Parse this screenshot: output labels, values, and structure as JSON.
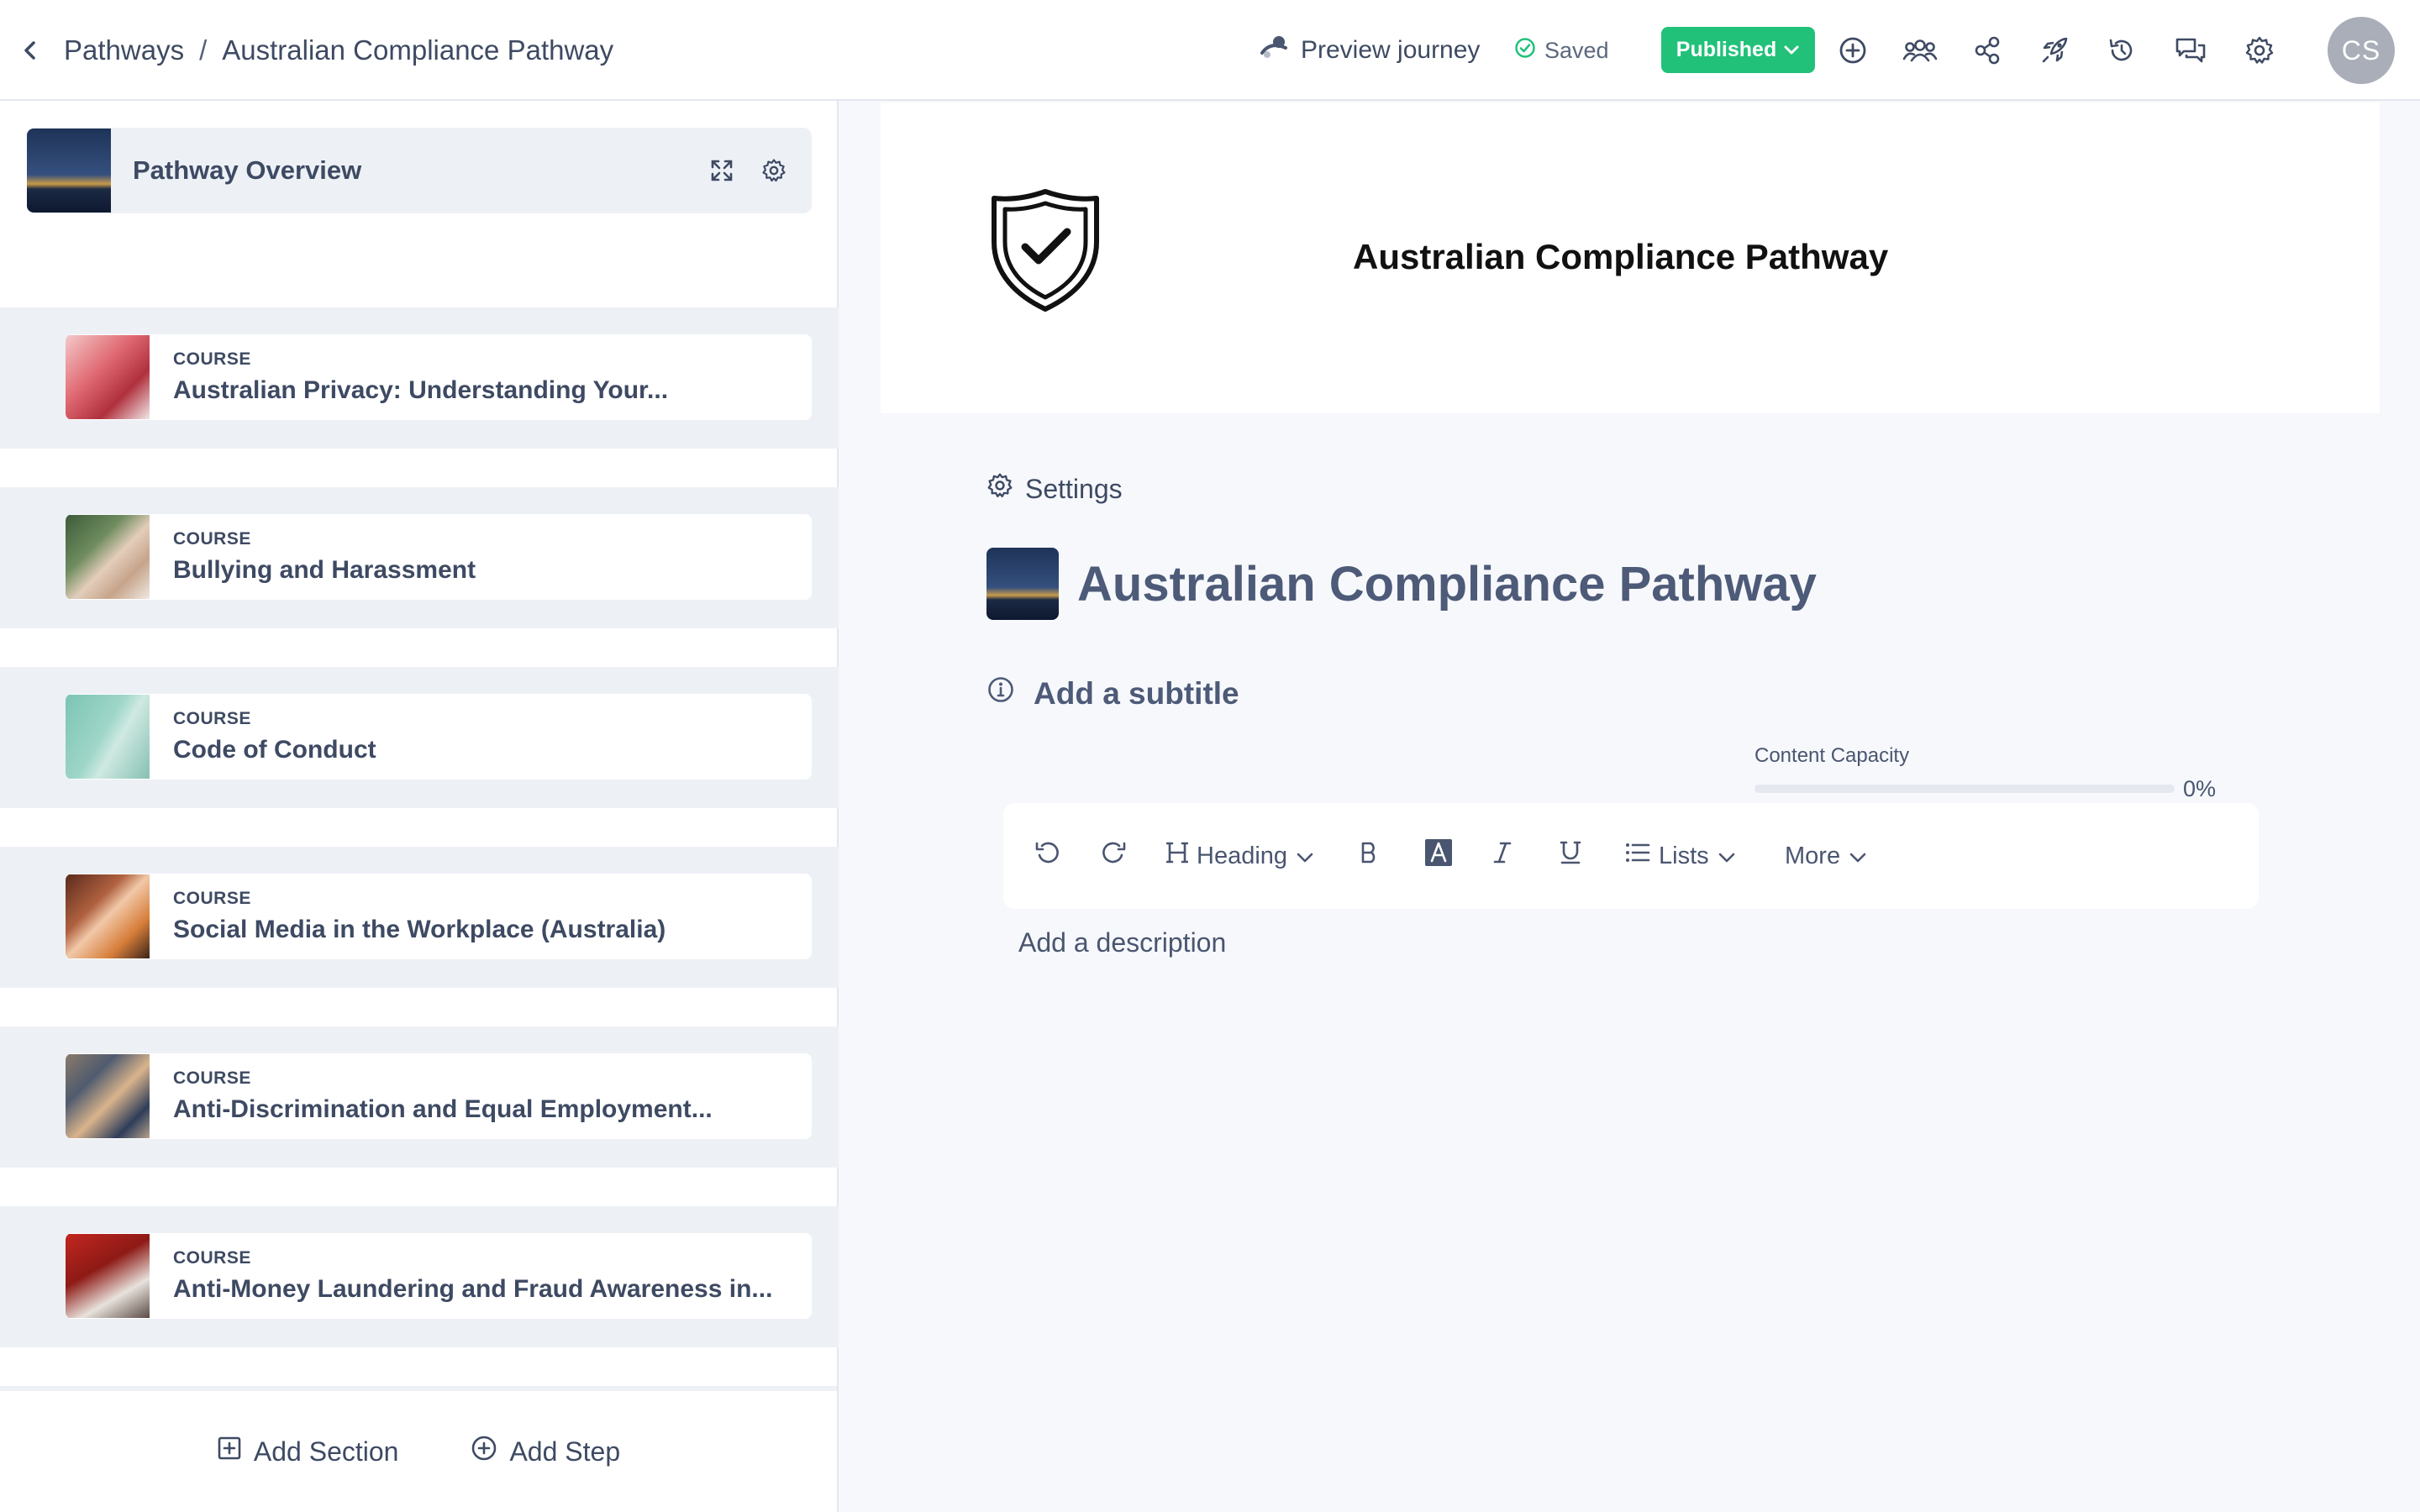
{
  "header": {
    "breadcrumb": [
      "Pathways",
      "/",
      "Australian Compliance Pathway"
    ],
    "preview_label": "Preview journey",
    "saved_label": "Saved",
    "status_label": "Published",
    "avatar_initials": "CS"
  },
  "sidebar": {
    "overview_label": "Pathway Overview",
    "steps": [
      {
        "kind": "COURSE",
        "title": "Australian Privacy: Understanding Your..."
      },
      {
        "kind": "COURSE",
        "title": "Bullying and Harassment"
      },
      {
        "kind": "COURSE",
        "title": "Code of Conduct"
      },
      {
        "kind": "COURSE",
        "title": "Social Media in the Workplace (Australia)"
      },
      {
        "kind": "COURSE",
        "title": "Anti-Discrimination and Equal Employment..."
      },
      {
        "kind": "COURSE",
        "title": "Anti-Money Laundering and Fraud Awareness in..."
      }
    ],
    "add_section_label": "Add Section",
    "add_step_label": "Add Step"
  },
  "main": {
    "banner_title": "Australian Compliance Pathway",
    "settings_label": "Settings",
    "title": "Australian Compliance Pathway",
    "subtitle_placeholder": "Add a subtitle",
    "capacity_label": "Content Capacity",
    "capacity_value": 0,
    "capacity_text": "0%",
    "toolbar": {
      "heading_label": "Heading",
      "lists_label": "Lists",
      "more_label": "More"
    },
    "description_placeholder": "Add a description"
  },
  "colors": {
    "accent_green": "#22c17a",
    "text_primary": "#3e4a63",
    "panel_bg": "#edf1f6"
  }
}
